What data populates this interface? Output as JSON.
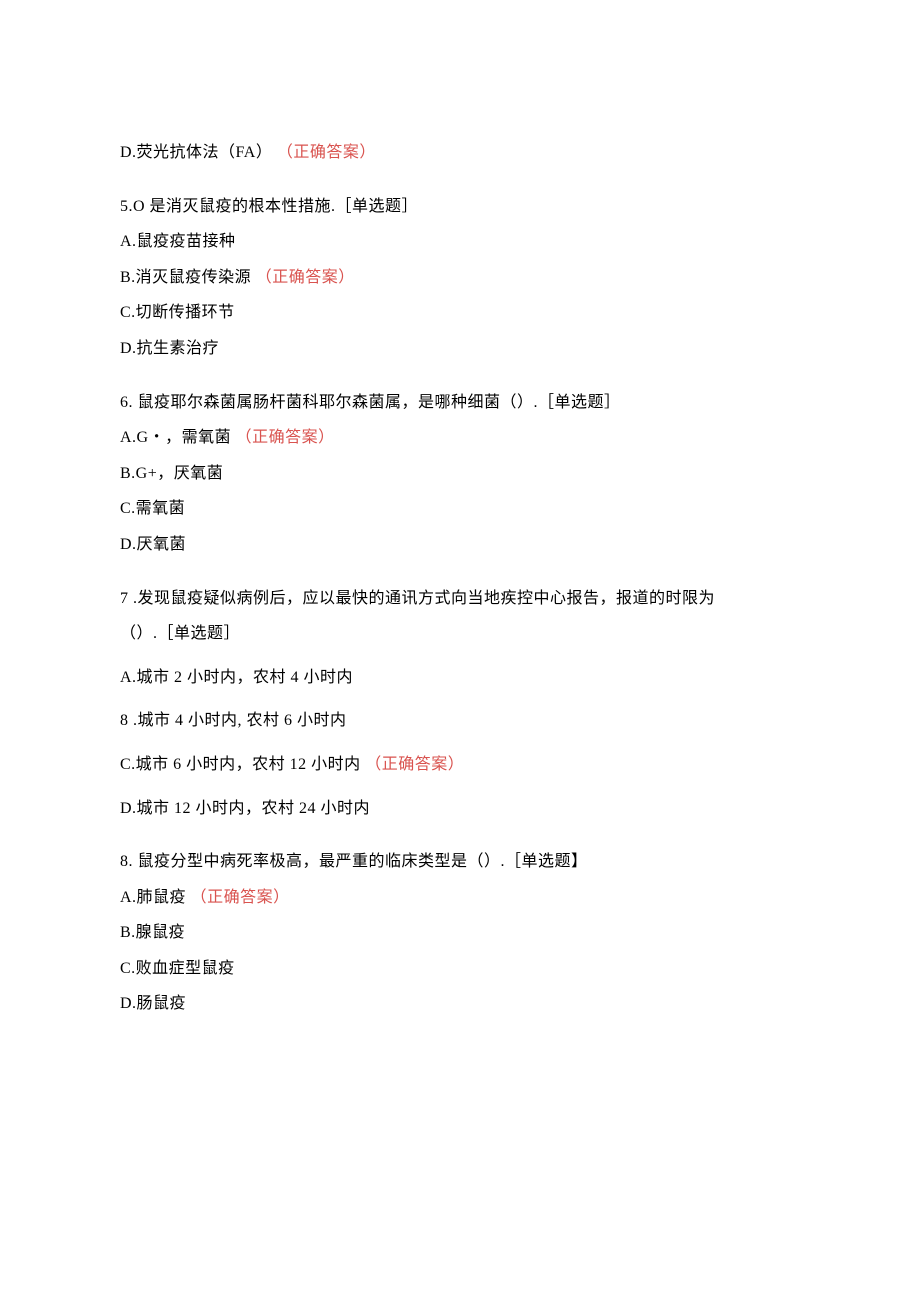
{
  "q4_optionD_prefix": "D.荧光抗体法（FA）",
  "q4_optionD_correct": "（正确答案）",
  "q5": {
    "stem": "5.O 是消灭鼠疫的根本性措施.［单选题］",
    "A": "A.鼠疫疫苗接种",
    "B_prefix": "B.消灭鼠疫传染源",
    "B_correct": "（正确答案）",
    "C": "C.切断传播环节",
    "D": "D.抗生素治疗"
  },
  "q6": {
    "stem": "6. 鼠疫耶尔森菌属肠杆菌科耶尔森菌属，是哪种细菌（）.［单选题］",
    "A_prefix": "A.G・，需氧菌",
    "A_correct": "（正确答案）",
    "B": "B.G+，厌氧菌",
    "C": "C.需氧菌",
    "D": "D.厌氧菌"
  },
  "q7": {
    "stem1": "7 .发现鼠疫疑似病例后，应以最快的通讯方式向当地疾控中心报告，报道的时限为",
    "stem2": "（）.［单选题］",
    "A": "A.城市 2 小时内，农村 4 小时内",
    "B": "8 .城市 4 小时内, 农村 6 小时内",
    "C_prefix": "C.城市 6 小时内，农村 12 小时内",
    "C_correct": "（正确答案）",
    "D": "D.城市 12 小时内，农村 24 小时内"
  },
  "q8": {
    "stem": "8. 鼠疫分型中病死率极高，最严重的临床类型是（）.［单选题】",
    "A_prefix": "A.肺鼠疫",
    "A_correct": "（正确答案）",
    "B": "B.腺鼠疫",
    "C": "C.败血症型鼠疫",
    "D": "D.肠鼠疫"
  }
}
